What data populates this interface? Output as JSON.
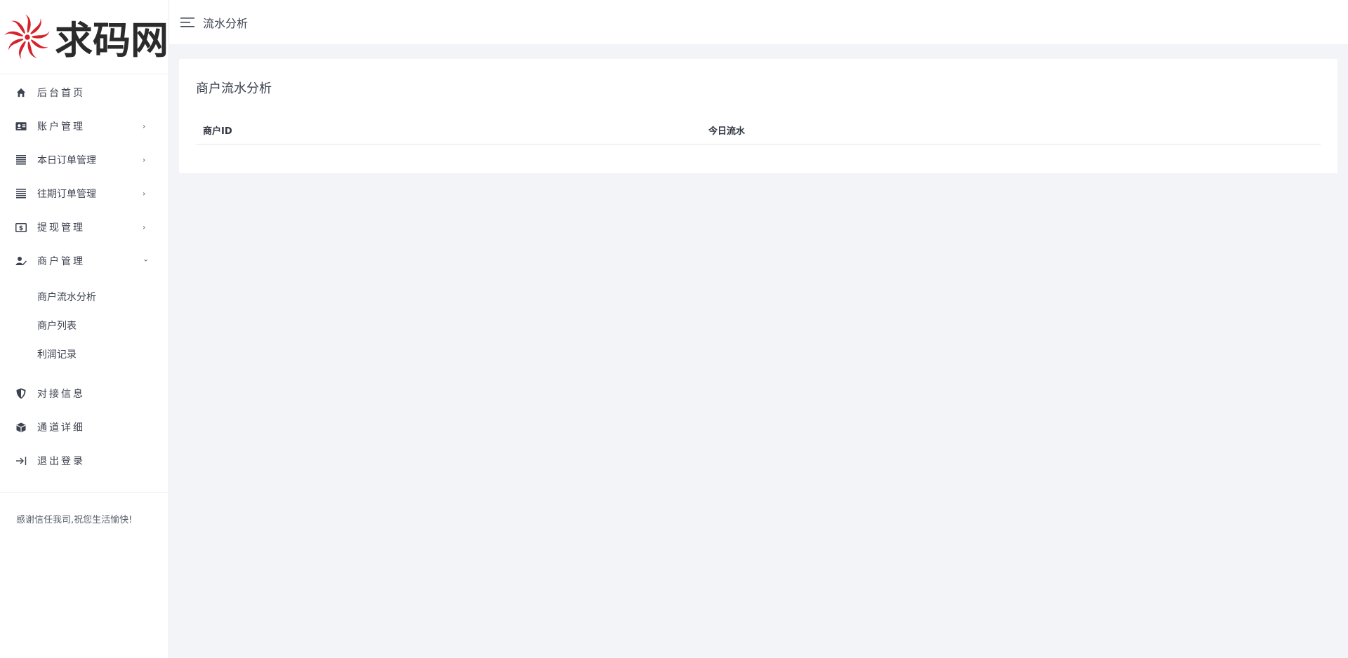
{
  "brand": {
    "logo_text": "求码网",
    "accent": "#d6222a"
  },
  "topbar": {
    "title": "流水分析"
  },
  "sidebar": {
    "items": [
      {
        "label": "后台首页",
        "icon": "home-icon",
        "arrow": ""
      },
      {
        "label": "账户管理",
        "icon": "id-card-icon",
        "arrow": "›"
      },
      {
        "label": "本日订单管理",
        "icon": "list-icon",
        "arrow": "›"
      },
      {
        "label": "往期订单管理",
        "icon": "list-icon",
        "arrow": "›"
      },
      {
        "label": "提现管理",
        "icon": "money-icon",
        "arrow": "›"
      },
      {
        "label": "商户管理",
        "icon": "user-edit-icon",
        "arrow": "⌄"
      }
    ],
    "submenu": [
      {
        "label": "商户流水分析"
      },
      {
        "label": "商户列表"
      },
      {
        "label": "利润记录"
      }
    ],
    "items_after": [
      {
        "label": "对接信息",
        "icon": "shield-icon"
      },
      {
        "label": "通道详细",
        "icon": "cube-icon"
      },
      {
        "label": "退出登录",
        "icon": "logout-icon"
      }
    ],
    "footer": "感谢信任我司,祝您生活愉快!"
  },
  "main": {
    "card_title": "商户流水分析",
    "table": {
      "headers": [
        "商户ID",
        "今日流水"
      ],
      "rows": []
    }
  }
}
